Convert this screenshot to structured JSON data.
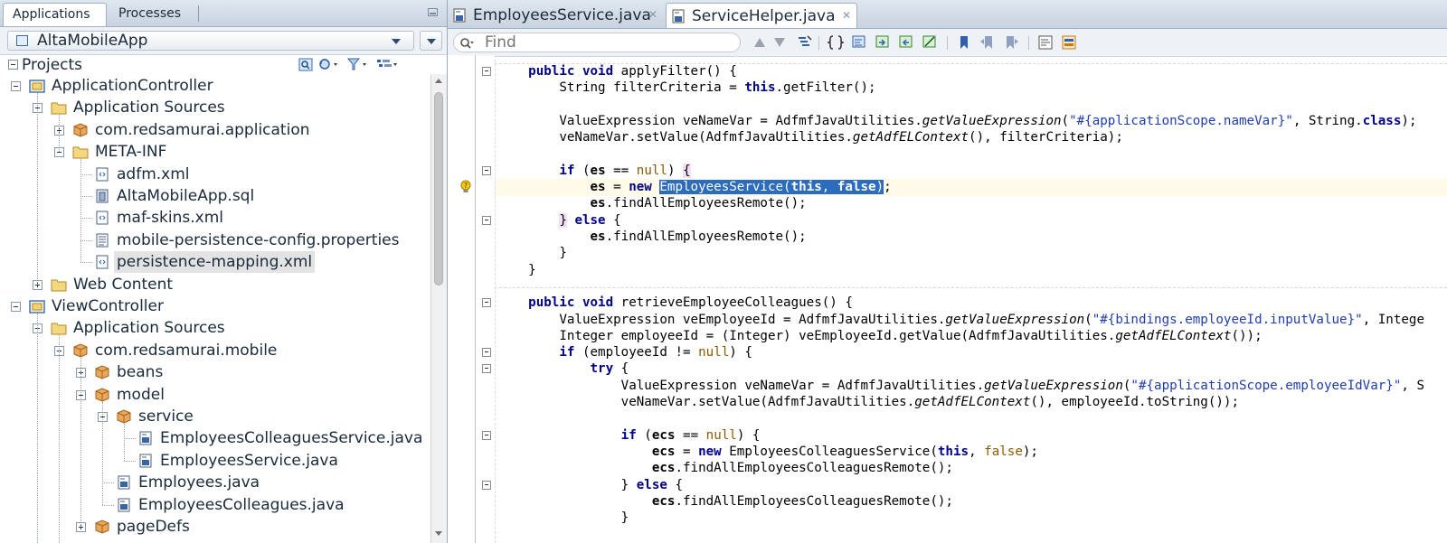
{
  "left_panel": {
    "tabs": [
      "Applications",
      "Processes"
    ],
    "app_selector": "AltaMobileApp",
    "projects_title": "Projects",
    "tree": [
      {
        "label": "ApplicationController",
        "level": 0,
        "icon": "project-icon",
        "expanded": true
      },
      {
        "label": "Application Sources",
        "level": 1,
        "icon": "folder-icon",
        "expanded": true
      },
      {
        "label": "com.redsamurai.application",
        "level": 2,
        "icon": "package-icon",
        "expanded": false
      },
      {
        "label": "META-INF",
        "level": 2,
        "icon": "folder-icon",
        "expanded": true
      },
      {
        "label": "adfm.xml",
        "level": 3,
        "icon": "xml-file-icon"
      },
      {
        "label": "AltaMobileApp.sql",
        "level": 3,
        "icon": "sql-file-icon"
      },
      {
        "label": "maf-skins.xml",
        "level": 3,
        "icon": "xml-file-icon"
      },
      {
        "label": "mobile-persistence-config.properties",
        "level": 3,
        "icon": "properties-file-icon"
      },
      {
        "label": "persistence-mapping.xml",
        "level": 3,
        "icon": "xml-file-icon",
        "selected": true
      },
      {
        "label": "Web Content",
        "level": 1,
        "icon": "folder-icon",
        "expanded": false
      },
      {
        "label": "ViewController",
        "level": 0,
        "icon": "project-icon",
        "expanded": true
      },
      {
        "label": "Application Sources",
        "level": 1,
        "icon": "folder-icon",
        "expanded": true
      },
      {
        "label": "com.redsamurai.mobile",
        "level": 2,
        "icon": "package-icon",
        "expanded": true
      },
      {
        "label": "beans",
        "level": 3,
        "icon": "package-icon",
        "expanded": false
      },
      {
        "label": "model",
        "level": 3,
        "icon": "package-icon",
        "expanded": true
      },
      {
        "label": "service",
        "level": 4,
        "icon": "package-icon",
        "expanded": true
      },
      {
        "label": "EmployeesColleaguesService.java",
        "level": 5,
        "icon": "java-file-icon"
      },
      {
        "label": "EmployeesService.java",
        "level": 5,
        "icon": "java-file-icon"
      },
      {
        "label": "Employees.java",
        "level": 4,
        "icon": "java-file-icon"
      },
      {
        "label": "EmployeesColleagues.java",
        "level": 4,
        "icon": "java-file-icon"
      },
      {
        "label": "pageDefs",
        "level": 3,
        "icon": "package-icon",
        "expanded": false
      }
    ]
  },
  "editor": {
    "tabs": [
      {
        "label": "EmployeesService.java",
        "active": false
      },
      {
        "label": "ServiceHelper.java",
        "active": true
      }
    ],
    "find_placeholder": "Find",
    "code_lines": [
      [
        "    ",
        "kw:public",
        " ",
        "kw:void",
        " applyFilter() {"
      ],
      [
        "        String filterCriteria = ",
        "kw:this",
        ".getFilter();"
      ],
      [
        ""
      ],
      [
        "        ValueExpression veNameVar = AdfmfJavaUtilities.",
        "it:getValueExpression",
        "(",
        "str:\"#{applicationScope.nameVar}\"",
        ", String.",
        "kw:class",
        ");"
      ],
      [
        "        veNameVar.setValue(AdfmfJavaUtilities.",
        "it:getAdfELContext",
        "(), filterCriteria);"
      ],
      [
        ""
      ],
      [
        "        ",
        "kw:if",
        " (",
        "bold:es",
        " == ",
        "lit:null",
        ") ",
        "brace:{"
      ],
      [
        "            ",
        "bold:es",
        " = ",
        "kw:new",
        " ",
        "sel:EmployeesService(",
        "selkw:this",
        "sel:, ",
        "selkw:false",
        "sel:)",
        ";"
      ],
      [
        "            ",
        "bold:es",
        ".findAllEmployeesRemote();"
      ],
      [
        "        ",
        "brace:}",
        " ",
        "kw:else",
        " {"
      ],
      [
        "            ",
        "bold:es",
        ".findAllEmployeesRemote();"
      ],
      [
        "        }"
      ],
      [
        "    }"
      ],
      [
        ""
      ],
      [
        "    ",
        "kw:public",
        " ",
        "kw:void",
        " retrieveEmployeeColleagues() {"
      ],
      [
        "        ValueExpression veEmployeeId = AdfmfJavaUtilities.",
        "it:getValueExpression",
        "(",
        "str:\"#{bindings.employeeId.inputValue}\"",
        ", Intege"
      ],
      [
        "        Integer employeeId = (Integer) veEmployeeId.getValue(AdfmfJavaUtilities.",
        "it:getAdfELContext",
        "());"
      ],
      [
        "        ",
        "kw:if",
        " (employeeId != ",
        "lit:null",
        ") {"
      ],
      [
        "            ",
        "kw:try",
        " {"
      ],
      [
        "                ValueExpression veNameVar = AdfmfJavaUtilities.",
        "it:getValueExpression",
        "(",
        "str:\"#{applicationScope.employeeIdVar}\"",
        ", S"
      ],
      [
        "                veNameVar.setValue(AdfmfJavaUtilities.",
        "it:getAdfELContext",
        "(), employeeId.toString());"
      ],
      [
        ""
      ],
      [
        "                ",
        "kw:if",
        " (",
        "bold:ecs",
        " == ",
        "lit:null",
        ") {"
      ],
      [
        "                    ",
        "bold:ecs",
        " = ",
        "kw:new",
        " EmployeesColleaguesService(",
        "kw:this",
        ", ",
        "lit:false",
        ");"
      ],
      [
        "                    ",
        "bold:ecs",
        ".findAllEmployeesColleaguesRemote();"
      ],
      [
        "                } ",
        "kw:else",
        " {"
      ],
      [
        "                    ",
        "bold:ecs",
        ".findAllEmployeesColleaguesRemote();"
      ],
      [
        "                }"
      ]
    ]
  }
}
